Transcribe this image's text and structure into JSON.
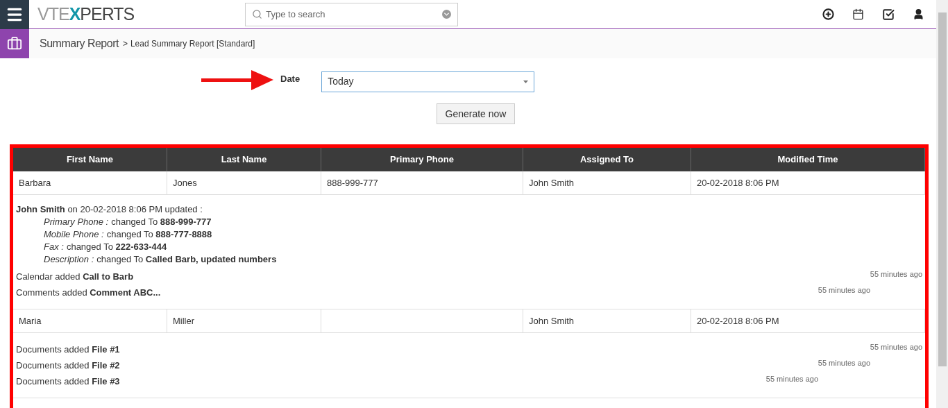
{
  "header": {
    "logo": [
      "VTE",
      "X",
      "PERTS"
    ],
    "search": {
      "placeholder": "Type to search"
    }
  },
  "breadcrumb": {
    "module": "Summary Report",
    "separator": ">",
    "page": "Lead Summary Report [Standard]"
  },
  "filter": {
    "label": "Date",
    "value": "Today",
    "button": "Generate now"
  },
  "table": {
    "columns": [
      "First Name",
      "Last Name",
      "Primary Phone",
      "Assigned To",
      "Modified Time"
    ],
    "rows": [
      {
        "cells": [
          "Barbara",
          "Jones",
          "888-999-777",
          "John Smith",
          "20-02-2018 8:06 PM"
        ],
        "activity": [
          {
            "kind": "update",
            "text": "**John Smith** on 20-02-2018 8:06 PM updated :",
            "changes": [
              {
                "field": "Primary Phone :",
                "text": "changed To **888-999-777**"
              },
              {
                "field": "Mobile Phone :",
                "text": "changed To **888-777-8888**"
              },
              {
                "field": "Fax :",
                "text": "changed To **222-633-444**"
              },
              {
                "field": "Description :",
                "text": "changed To **Called Barb, updated numbers**"
              }
            ]
          },
          {
            "kind": "event",
            "text": "Calendar added **Call to Barb**",
            "time": "55 minutes ago"
          },
          {
            "kind": "event",
            "text": "Comments added **Comment ABC...**",
            "time": "55 minutes ago"
          }
        ]
      },
      {
        "cells": [
          "Maria",
          "Miller",
          "",
          "John Smith",
          "20-02-2018 8:06 PM"
        ],
        "activity": [
          {
            "kind": "event",
            "text": "Documents added **File #1**",
            "time": "55 minutes ago"
          },
          {
            "kind": "event",
            "text": "Documents added **File #2**",
            "time": "55 minutes ago"
          },
          {
            "kind": "event",
            "text": "Documents added **File #3**",
            "time": "55 minutes ago"
          }
        ]
      }
    ]
  }
}
